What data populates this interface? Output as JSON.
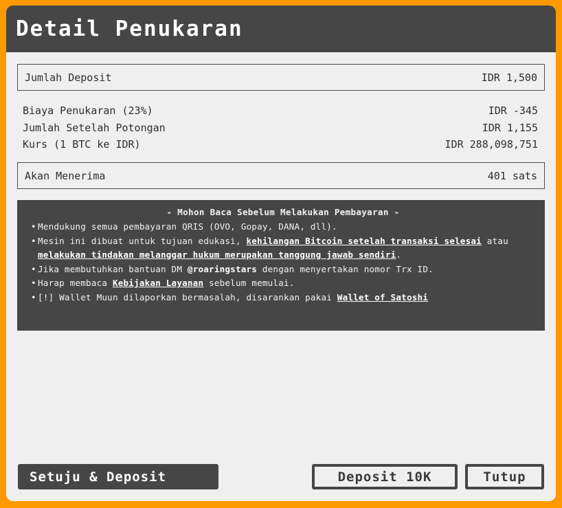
{
  "header": {
    "title": "Detail Penukaran"
  },
  "summary": {
    "deposit_label": "Jumlah Deposit",
    "deposit_value": "IDR 1,500",
    "fee_label": "Biaya Penukaran (23%)",
    "fee_value": "IDR -345",
    "after_label": "Jumlah Setelah Potongan",
    "after_value": "IDR 1,155",
    "rate_label": "Kurs (1 BTC ke IDR)",
    "rate_value": "IDR 288,098,751",
    "receive_label": "Akan Menerima",
    "receive_value": "401 sats"
  },
  "notice": {
    "title": "- Mohon Baca Sebelum Melakukan Pembayaran -",
    "item1": "Mendukung semua pembayaran QRIS (OVO, Gopay, DANA, dll).",
    "item2_pre": "Mesin ini dibuat untuk tujuan edukasi, ",
    "item2_link1": "kehilangan Bitcoin setelah transaksi selesai",
    "item2_mid": " atau ",
    "item2_link2": "melakukan tindakan melanggar hukum merupakan tanggung jawab sendiri",
    "item2_post": ".",
    "item3_pre": "Jika membutuhkan bantuan DM ",
    "item3_handle": "@roaringstars",
    "item3_post": " dengan menyertakan nomor Trx ID.",
    "item4_pre": "Harap membaca ",
    "item4_link": "Kebijakan Layanan",
    "item4_post": " sebelum memulai.",
    "item5_pre": "[!] Wallet Muun dilaporkan bermasalah, disarankan pakai ",
    "item5_link": "Wallet of Satoshi"
  },
  "buttons": {
    "agree": "Setuju & Deposit",
    "deposit10k": "Deposit 10K",
    "close": "Tutup"
  }
}
